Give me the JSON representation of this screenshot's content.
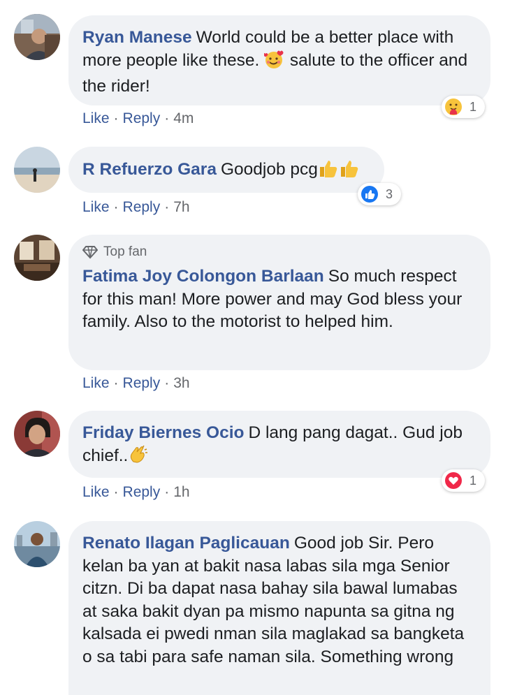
{
  "comments": [
    {
      "author": "Ryan Manese",
      "text_parts": [
        "World could be a better place with more people like these. ",
        " salute to the officer and the rider!"
      ],
      "inline_emoji": "smiling-face-with-hearts",
      "like_label": "Like",
      "reply_label": "Reply",
      "time": "4m",
      "reactions": {
        "icon": "care-reaction",
        "count": "1"
      }
    },
    {
      "author": "R Refuerzo Gara",
      "text": "Goodjob pcg",
      "inline_emoji": "thumbs-up",
      "like_label": "Like",
      "reply_label": "Reply",
      "time": "7h",
      "reactions": {
        "icon": "like-reaction",
        "count": "3",
        "color": "#1877f2"
      }
    },
    {
      "badge": "Top fan",
      "author": "Fatima Joy Colongon Barlaan",
      "text": "So much respect for this man! More power and may God bless your family. Also to the motorist to helped him.",
      "like_label": "Like",
      "reply_label": "Reply",
      "time": "3h"
    },
    {
      "author": "Friday Biernes Ocio",
      "text": "D lang pang dagat.. Gud job chief..",
      "inline_emoji": "clapping-hands",
      "like_label": "Like",
      "reply_label": "Reply",
      "time": "1h",
      "reactions": {
        "icon": "love-reaction",
        "count": "1",
        "color": "#f02849"
      }
    },
    {
      "author": "Renato Ilagan Paglicauan",
      "text": "Good job Sir. Pero kelan ba yan at bakit nasa labas sila mga Senior citzn. Di ba dapat nasa bahay sila bawal lumabas at saka bakit dyan pa mismo napunta sa gitna ng kalsada ei pwedi nman sila maglakad sa bangketa o sa tabi para safe naman sila. Something wrong"
    }
  ],
  "separator": "·",
  "colors": {
    "author": "#385898",
    "bubble": "#f0f2f5",
    "meta": "#65676b"
  }
}
